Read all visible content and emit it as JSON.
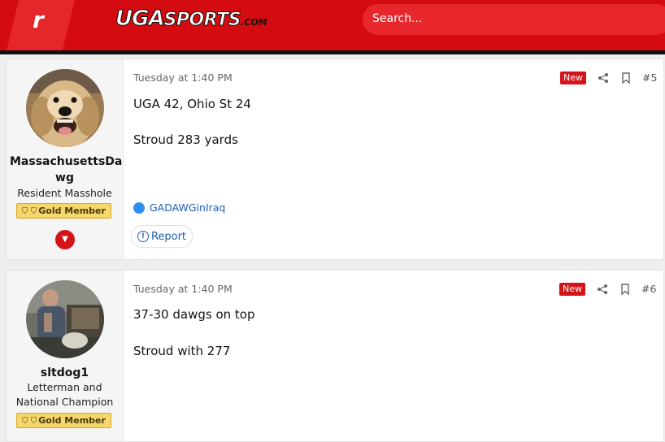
{
  "header": {
    "rivals_letter": "r",
    "logo_main": "UGA",
    "logo_sports": "SPORTS",
    "logo_com": ".COM",
    "search_placeholder": "Search..."
  },
  "posts": [
    {
      "username": "MassachusettsDawg",
      "username_line1": "MassachusettsDa",
      "username_line2": "wg",
      "title_line1": "Resident Masshole",
      "title_line2": "",
      "badge": "Gold Member",
      "date": "Tuesday at 1:40 PM",
      "new_label": "New",
      "number": "#5",
      "lines": [
        "UGA 42, Ohio St 24",
        "Stroud 283 yards"
      ],
      "reaction_user": "GADAWGinIraq",
      "report_label": "Report"
    },
    {
      "username": "sltdog1",
      "title_line1": "Letterman and",
      "title_line2": "National Champion",
      "badge": "Gold Member",
      "date": "Tuesday at 1:40 PM",
      "new_label": "New",
      "number": "#6",
      "lines": [
        "37-30 dawgs on top",
        "Stroud with 277"
      ]
    }
  ],
  "icons": {
    "expand": "chevron-down-icon",
    "share": "share-icon",
    "bookmark": "bookmark-icon",
    "like": "like-icon",
    "report": "info-icon"
  },
  "colors": {
    "header_red": "#d40b10",
    "badge_gold": "#f5d76e",
    "new_red": "#d4141b",
    "link_blue": "#1a5fb4"
  }
}
